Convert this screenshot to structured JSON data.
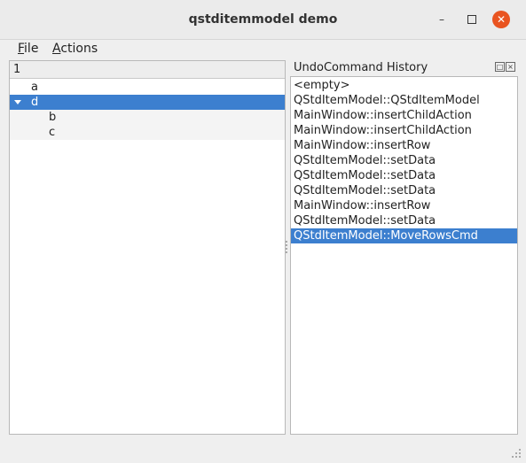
{
  "window": {
    "title": "qstditemmodel demo"
  },
  "menubar": {
    "items": [
      {
        "label": "File",
        "mnemonic": "F",
        "rest": "ile"
      },
      {
        "label": "Actions",
        "mnemonic": "A",
        "rest": "ctions"
      }
    ]
  },
  "tree": {
    "header": "1",
    "rows": [
      {
        "label": "a",
        "depth": 0,
        "expanded": null,
        "selected": false
      },
      {
        "label": "d",
        "depth": 0,
        "expanded": true,
        "selected": true
      },
      {
        "label": "b",
        "depth": 1,
        "expanded": null,
        "selected": false
      },
      {
        "label": "c",
        "depth": 1,
        "expanded": null,
        "selected": false
      }
    ]
  },
  "dock": {
    "title": "UndoCommand History",
    "float_icon": "float-icon",
    "close_icon": "close-icon"
  },
  "undo_history": {
    "items": [
      "<empty>",
      "QStdItemModel::QStdItemModel",
      "MainWindow::insertChildAction",
      "MainWindow::insertChildAction",
      "MainWindow::insertRow",
      "QStdItemModel::setData",
      "QStdItemModel::setData",
      "QStdItemModel::setData",
      "MainWindow::insertRow",
      "QStdItemModel::setData",
      "QStdItemModel::MoveRowsCmd"
    ],
    "selected_index": 10
  },
  "colors": {
    "selection": "#3c7fcf",
    "close_button": "#e95420"
  }
}
